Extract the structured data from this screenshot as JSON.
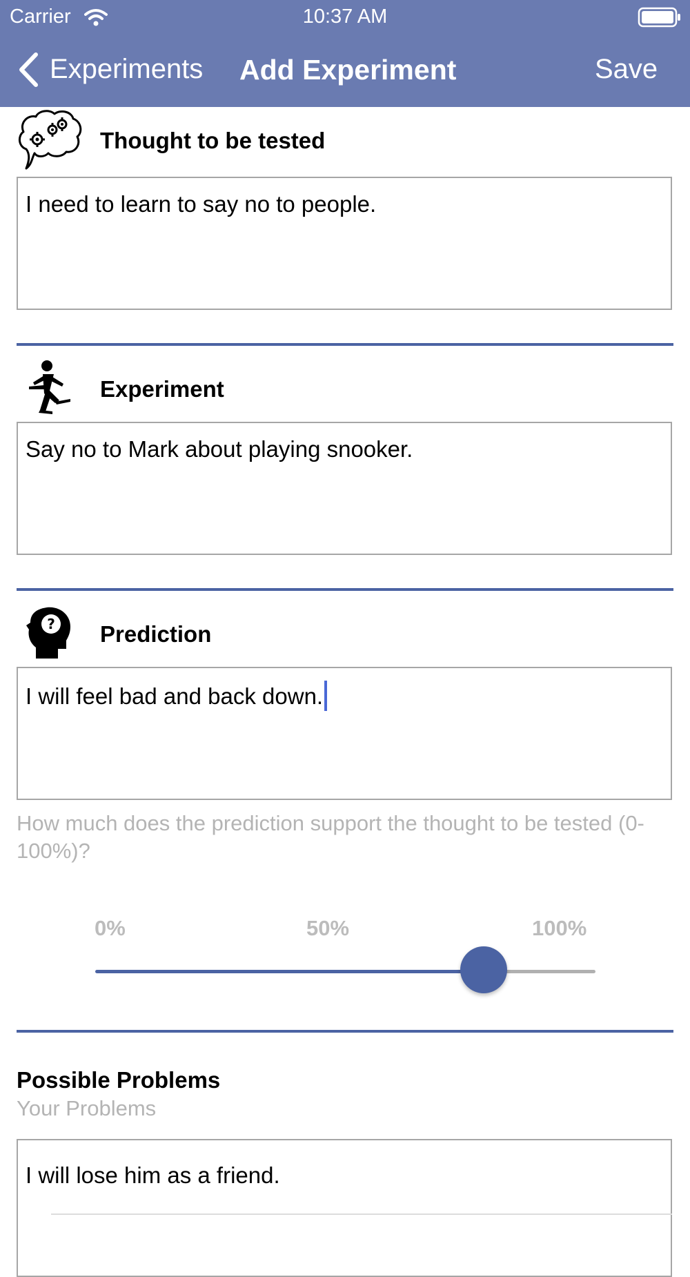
{
  "status_bar": {
    "carrier": "Carrier",
    "time": "10:37 AM"
  },
  "nav": {
    "back_label": "Experiments",
    "title": "Add Experiment",
    "save_label": "Save"
  },
  "sections": {
    "thought": {
      "heading": "Thought to be tested",
      "icon": "brain-gears-icon",
      "value": "I need to learn to say no to people."
    },
    "experiment": {
      "heading": "Experiment",
      "icon": "running-person-icon",
      "value": "Say no to Mark about playing snooker."
    },
    "prediction": {
      "heading": "Prediction",
      "icon": "head-question-icon",
      "value": "I will feel bad and back down."
    }
  },
  "support": {
    "question": "How much does the prediction support the thought to be tested (0-100%)?",
    "tick_labels": [
      "0%",
      "50%",
      "100%"
    ],
    "value_percent": 78
  },
  "problems": {
    "heading": "Possible Problems",
    "subtitle": "Your Problems",
    "items": [
      "I will lose him as a friend."
    ]
  },
  "colors": {
    "nav_background": "#6a7bb1",
    "accent": "#4b63a3",
    "caret": "#4a68d6",
    "placeholder_gray": "#b4b4b4"
  }
}
